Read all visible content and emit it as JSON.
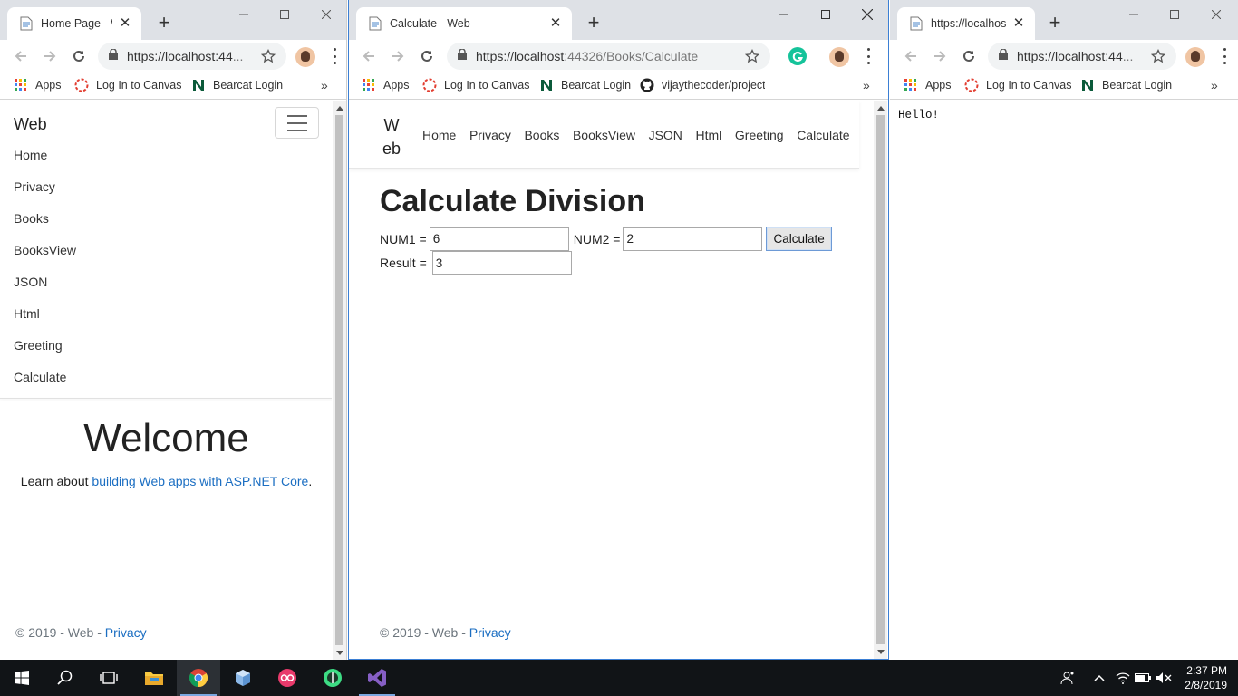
{
  "windows": {
    "left": {
      "tab_title": "Home Page - W",
      "url_main": "https://localhost:44",
      "url_rest": "...",
      "bookmarks": [
        "Apps",
        "Log In to Canvas",
        "Bearcat Login"
      ],
      "brand": "Web",
      "nav": [
        "Home",
        "Privacy",
        "Books",
        "BooksView",
        "JSON",
        "Html",
        "Greeting",
        "Calculate"
      ],
      "welcome": "Welcome",
      "learn_prefix": "Learn about ",
      "learn_link": "building Web apps with ASP.NET Core",
      "learn_suffix": ".",
      "footer_text": "© 2019 - Web - ",
      "footer_link": "Privacy"
    },
    "middle": {
      "tab_title": "Calculate - Web",
      "url_main": "https://localhost",
      "url_rest": ":44326/Books/Calculate",
      "bookmarks": [
        "Apps",
        "Log In to Canvas",
        "Bearcat Login",
        "vijaythecoder/project"
      ],
      "brand": "Web",
      "nav": [
        "Home",
        "Privacy",
        "Books",
        "BooksView",
        "JSON",
        "Html",
        "Greeting",
        "Calculate"
      ],
      "heading": "Calculate Division",
      "num1_label": "NUM1 =",
      "num1_value": "6",
      "num2_label": "NUM2 =",
      "num2_value": "2",
      "calc_button": "Calculate",
      "result_label": "Result =",
      "result_value": "3",
      "footer_text": "© 2019 - Web - ",
      "footer_link": "Privacy"
    },
    "right": {
      "tab_title": "https://localhost",
      "url_main": "https://localhost:44",
      "url_rest": "...",
      "bookmarks": [
        "Apps",
        "Log In to Canvas",
        "Bearcat Login"
      ],
      "body_text": "Hello!"
    }
  },
  "taskbar": {
    "time": "2:37 PM",
    "date": "2/8/2019"
  },
  "colors": {
    "link": "#1b6ec2",
    "active_window_border": "#3b7fd4",
    "taskbar": "#111417"
  }
}
